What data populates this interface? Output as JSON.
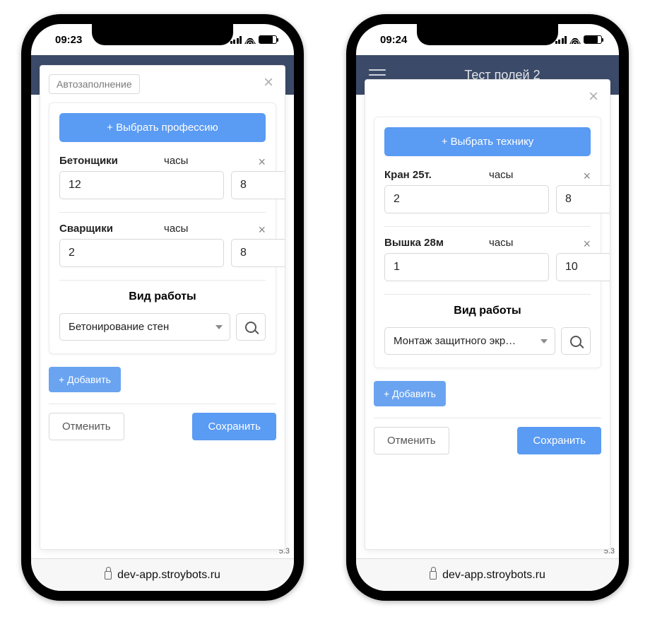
{
  "phones": [
    {
      "time": "09:23",
      "appbar_title": "",
      "chip": "Автозаполнение",
      "show_chip": true,
      "select_button": "+ Выбрать профессию",
      "rows": [
        {
          "label": "Бетонщики",
          "hours_label": "часы",
          "count": "12",
          "hours": "8"
        },
        {
          "label": "Сварщики",
          "hours_label": "часы",
          "count": "2",
          "hours": "8"
        }
      ],
      "work_title": "Вид работы",
      "work_value": "Бетонирование стен",
      "add_label": "+ Добавить",
      "cancel_label": "Отменить",
      "save_label": "Сохранить",
      "behind_badge": "5.3",
      "url": "dev-app.stroybots.ru"
    },
    {
      "time": "09:24",
      "appbar_title": "Тест полей 2",
      "chip": "",
      "show_chip": false,
      "select_button": "+ Выбрать технику",
      "rows": [
        {
          "label": "Кран 25т.",
          "hours_label": "часы",
          "count": "2",
          "hours": "8"
        },
        {
          "label": "Вышка 28м",
          "hours_label": "часы",
          "count": "1",
          "hours": "10"
        }
      ],
      "work_title": "Вид работы",
      "work_value": "Монтаж защитного экр…",
      "add_label": "+ Добавить",
      "cancel_label": "Отменить",
      "save_label": "Сохранить",
      "behind_badge": "5.3",
      "url": "dev-app.stroybots.ru"
    }
  ]
}
